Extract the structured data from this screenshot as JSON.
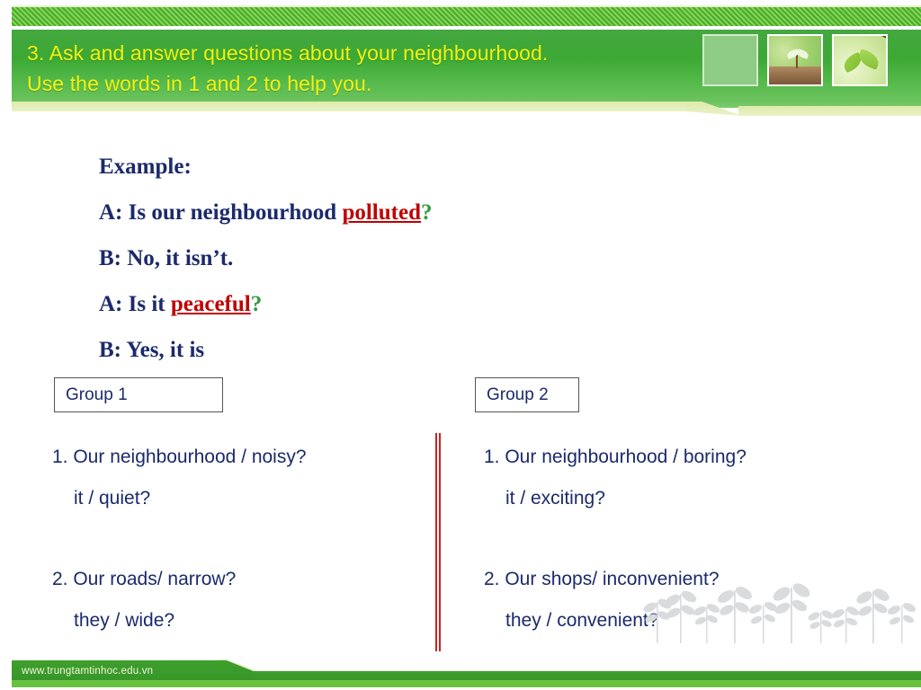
{
  "header": {
    "title": "3. Ask and answer questions about your neighbourhood.\nUse the words in 1 and 2 to help you.",
    "thumbnails": [
      {
        "name": "blank-green-thumbnail",
        "alt": "plain light green panel"
      },
      {
        "name": "seedling-thumbnail",
        "alt": "seedling sprouting in soil"
      },
      {
        "name": "leaves-thumbnail",
        "alt": "green leaves on a branch"
      }
    ],
    "colors": {
      "green_dark": "#2f9e2b",
      "green_light": "#6cc35e",
      "title_yellow": "#f2f312",
      "cream": "#e7f0c6"
    }
  },
  "example": {
    "heading": "Example:",
    "lines": [
      {
        "prefix": "A: Is our neighbourhood ",
        "highlight": "polluted",
        "suffix": "?"
      },
      {
        "prefix": "B: No, it isn’t.",
        "highlight": "",
        "suffix": ""
      },
      {
        "prefix": "A: Is it ",
        "highlight": "peaceful",
        "suffix": "?"
      },
      {
        "prefix": "B: Yes, it is",
        "highlight": "",
        "suffix": ""
      }
    ],
    "colors": {
      "text": "#1b2a6b",
      "highlight": "#c00000",
      "question_mark": "#2f9e3e"
    }
  },
  "groups": [
    {
      "label": "Group 1",
      "items": [
        {
          "main": "1. Our neighbourhood / noisy?",
          "sub": "it / quiet?"
        },
        {
          "main": "2. Our roads/ narrow?",
          "sub": "they / wide?"
        }
      ]
    },
    {
      "label": "Group 2",
      "items": [
        {
          "main": "1. Our neighbourhood / boring?",
          "sub": "it / exciting?"
        },
        {
          "main": "2. Our shops/ inconvenient?",
          "sub": "they / convenient?"
        }
      ]
    }
  ],
  "divider": {
    "name": "vertical-red-divider",
    "color": "#cc2222"
  },
  "decoration": {
    "seedlings": "gray seedling silhouettes"
  },
  "footer": {
    "url": "www.trungtamtinhoc.edu.vn"
  }
}
